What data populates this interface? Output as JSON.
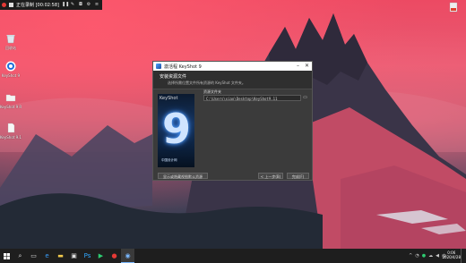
{
  "recorder": {
    "status_text": "正在录制 [00:02:58]"
  },
  "desktop": {
    "icons": [
      {
        "label": "回收站",
        "icon": "recycle-bin-icon"
      },
      {
        "label": "KeyShot 9",
        "icon": "keyshot-icon"
      },
      {
        "label": "KeyShot 9 Resources",
        "icon": "folder-icon"
      },
      {
        "label": "KeyShot 9.1",
        "icon": "document-icon"
      }
    ],
    "right_icon": {
      "icon": "app-icon"
    }
  },
  "dialog": {
    "window_title": "激活程 KeyShot 9",
    "heading": "安装资源文件",
    "subheading": "选择所需位置文件所有资源的 KeyShot 文件夹。",
    "splash_brand": "KeyShot",
    "splash_number": "9",
    "splash_caption": "中国设计网",
    "field_label": "资源文件夹",
    "path_value": "C:\\Users\\xiao\\Desktop\\KeyShot9.11",
    "left_button": "显示或隐藏视图默认资源",
    "back_button": "< 上一步(B)",
    "finish_button": "完成(F)"
  },
  "taskbar": {
    "items": [
      "windows-icon",
      "search-icon",
      "task-view-icon",
      "edge-icon",
      "file-explorer-icon",
      "store-icon",
      "photoshop-icon",
      "player-icon",
      "recorder-icon",
      "keyshot-icon"
    ],
    "clock_time": "0:06",
    "clock_date": "2020/4/28"
  },
  "colors": {
    "accent": "#7ab8ff",
    "record": "#e53935"
  }
}
